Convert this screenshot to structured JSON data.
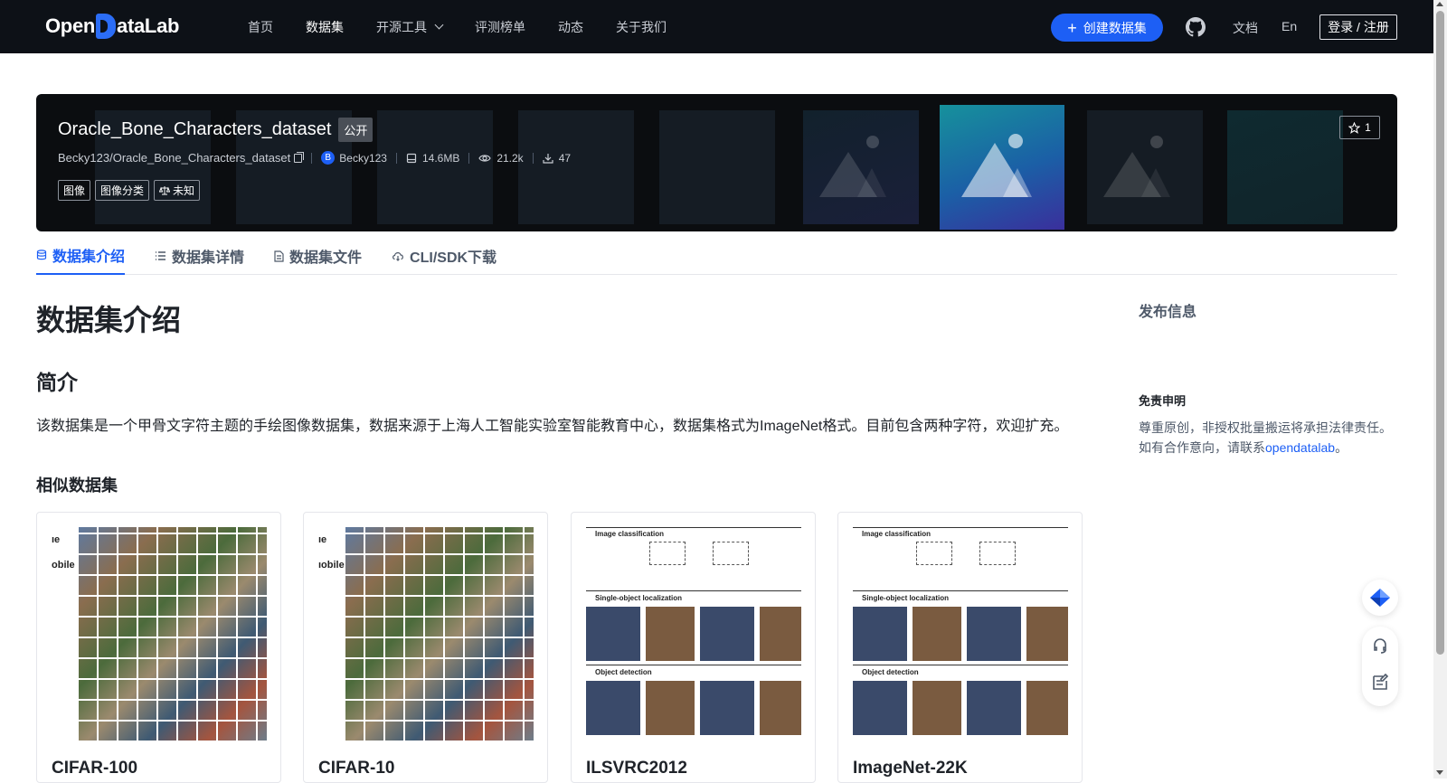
{
  "nav": {
    "logo_text_1": "Open",
    "logo_text_2": "ataLab",
    "links": [
      "首页",
      "数据集",
      "开源工具",
      "评测榜单",
      "动态",
      "关于我们"
    ],
    "active_link": "数据集",
    "create_label": "创建数据集",
    "docs_label": "文档",
    "lang_label": "En",
    "login_label": "登录 / 注册"
  },
  "dataset": {
    "title": "Oracle_Bone_Characters_dataset",
    "visibility": "公开",
    "full_name": "Becky123/Oracle_Bone_Characters_dataset",
    "owner_initial": "B",
    "owner": "Becky123",
    "size": "14.6MB",
    "views": "21.2k",
    "downloads": "47",
    "tags": [
      "图像",
      "图像分类",
      "未知"
    ],
    "stars": "1"
  },
  "tabs": [
    "数据集介绍",
    "数据集详情",
    "数据集文件",
    "CLI/SDK下载"
  ],
  "active_tab": "数据集介绍",
  "content": {
    "heading": "数据集介绍",
    "section_intro": "简介",
    "intro_text": "该数据集是一个甲骨文字符主题的手绘图像数据集，数据来源于上海人工智能实验室智能教育中心，数据集格式为ImageNet格式。目前包含两种字符，欢迎扩充。",
    "similar_heading": "相似数据集",
    "similar": [
      {
        "title": "CIFAR-100",
        "side_text_1": "ıe",
        "side_text_2": "obile"
      },
      {
        "title": "CIFAR-10",
        "side_text_1": "ıe",
        "side_text_2": "ıobile"
      },
      {
        "title": "ILSVRC2012",
        "label_1": "Image classification",
        "label_2": "Single-object localization",
        "label_3": "Object detection"
      },
      {
        "title": "ImageNet-22K",
        "label_1": "Image classification",
        "label_2": "Single-object localization",
        "label_3": "Object detection"
      }
    ]
  },
  "sidebar": {
    "publish_info": "发布信息",
    "disclaimer_title": "免责申明",
    "disclaimer_line1": "尊重原创，非授权批量搬运将承担法律责任。",
    "disclaimer_line2_pre": "如有合作意向，请联系",
    "disclaimer_link": "opendatalab",
    "disclaimer_line2_post": "。"
  },
  "colors": {
    "nav_bg": "#0d1117",
    "primary": "#1d5ff5",
    "banner_bg": "#0b0d10"
  },
  "icons": [
    "github-icon",
    "copy-icon",
    "storage-icon",
    "eye-icon",
    "download-icon",
    "scale-icon",
    "star-icon",
    "database-icon",
    "list-icon",
    "file-icon",
    "cloud-icon",
    "assistant-icon",
    "headset-icon",
    "feedback-icon"
  ]
}
